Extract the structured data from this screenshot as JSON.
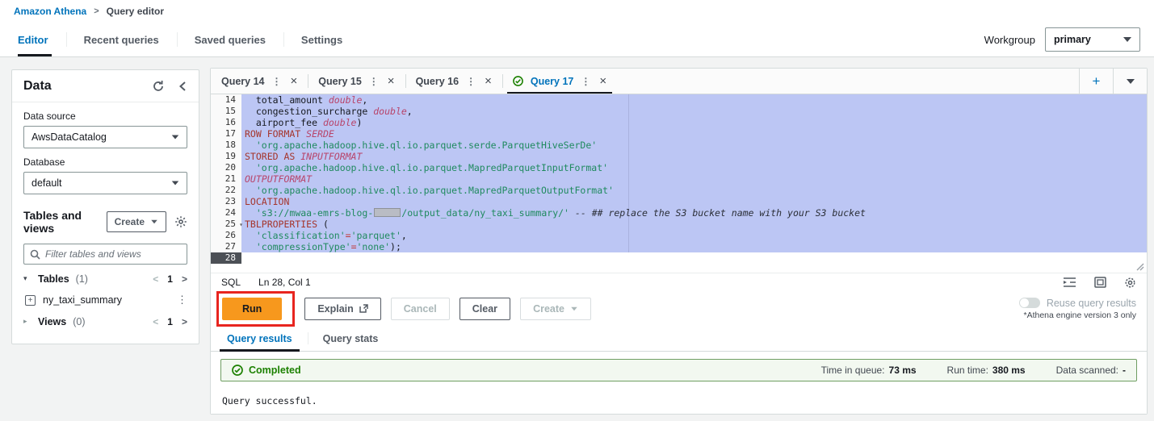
{
  "breadcrumb": {
    "root": "Amazon Athena",
    "sep": ">",
    "current": "Query editor"
  },
  "top_tabs": [
    {
      "label": "Editor",
      "active": true
    },
    {
      "label": "Recent queries",
      "active": false
    },
    {
      "label": "Saved queries",
      "active": false
    },
    {
      "label": "Settings",
      "active": false
    }
  ],
  "workgroup": {
    "label": "Workgroup",
    "value": "primary"
  },
  "sidebar": {
    "title": "Data",
    "data_source": {
      "label": "Data source",
      "value": "AwsDataCatalog"
    },
    "database": {
      "label": "Database",
      "value": "default"
    },
    "tables_and_views": {
      "title": "Tables and views",
      "create_button": "Create",
      "filter_placeholder": "Filter tables and views",
      "groups": [
        {
          "label": "Tables",
          "count": "(1)",
          "expanded": true,
          "prev": "<",
          "page": "1",
          "next": ">",
          "items": [
            "ny_taxi_summary"
          ]
        },
        {
          "label": "Views",
          "count": "(0)",
          "expanded": false,
          "prev": "<",
          "page": "1",
          "next": ">",
          "items": []
        }
      ]
    }
  },
  "editor": {
    "tabs": [
      {
        "label": "Query 14",
        "active": false,
        "completed": false
      },
      {
        "label": "Query 15",
        "active": false,
        "completed": false
      },
      {
        "label": "Query 16",
        "active": false,
        "completed": false
      },
      {
        "label": "Query 17",
        "active": true,
        "completed": true
      }
    ],
    "language": "SQL",
    "cursor_position": "Ln 28, Col 1",
    "lines": [
      {
        "num": "14",
        "selected": true,
        "segments": [
          {
            "t": "  total_amount ",
            "s": "p"
          },
          {
            "t": "double",
            "s": "t"
          },
          {
            "t": ",",
            "s": "p"
          }
        ]
      },
      {
        "num": "15",
        "selected": true,
        "segments": [
          {
            "t": "  congestion_surcharge ",
            "s": "p"
          },
          {
            "t": "double",
            "s": "t"
          },
          {
            "t": ",",
            "s": "p"
          }
        ]
      },
      {
        "num": "16",
        "selected": true,
        "segments": [
          {
            "t": "  airport_fee ",
            "s": "p"
          },
          {
            "t": "double",
            "s": "t"
          },
          {
            "t": ")",
            "s": "p"
          }
        ]
      },
      {
        "num": "17",
        "selected": true,
        "segments": [
          {
            "t": "ROW FORMAT ",
            "s": "k"
          },
          {
            "t": "SERDE",
            "s": "ki"
          }
        ]
      },
      {
        "num": "18",
        "selected": true,
        "segments": [
          {
            "t": "  ",
            "s": "p"
          },
          {
            "t": "'org.apache.hadoop.hive.ql.io.parquet.serde.ParquetHiveSerDe'",
            "s": "s"
          }
        ]
      },
      {
        "num": "19",
        "selected": true,
        "segments": [
          {
            "t": "STORED AS ",
            "s": "k"
          },
          {
            "t": "INPUTFORMAT",
            "s": "ki"
          }
        ]
      },
      {
        "num": "20",
        "selected": true,
        "segments": [
          {
            "t": "  ",
            "s": "p"
          },
          {
            "t": "'org.apache.hadoop.hive.ql.io.parquet.MapredParquetInputFormat'",
            "s": "s"
          }
        ]
      },
      {
        "num": "21",
        "selected": true,
        "segments": [
          {
            "t": "OUTPUTFORMAT",
            "s": "ki"
          }
        ]
      },
      {
        "num": "22",
        "selected": true,
        "segments": [
          {
            "t": "  ",
            "s": "p"
          },
          {
            "t": "'org.apache.hadoop.hive.ql.io.parquet.MapredParquetOutputFormat'",
            "s": "s"
          }
        ]
      },
      {
        "num": "23",
        "selected": true,
        "segments": [
          {
            "t": "LOCATION",
            "s": "k"
          }
        ]
      },
      {
        "num": "24",
        "selected": true,
        "segments": [
          {
            "t": "  ",
            "s": "p"
          },
          {
            "t": "'s3://mwaa-emrs-blog-",
            "s": "s"
          },
          {
            "t": "",
            "s": "r"
          },
          {
            "t": "/output_data/ny_taxi_summary/'",
            "s": "s"
          },
          {
            "t": " ",
            "s": "p"
          },
          {
            "t": "-- ## replace the S3 bucket name with your S3 bucket",
            "s": "c"
          }
        ]
      },
      {
        "num": "25",
        "selected": true,
        "fold": true,
        "segments": [
          {
            "t": "TBLPROPERTIES ",
            "s": "k"
          },
          {
            "t": "(",
            "s": "p"
          }
        ]
      },
      {
        "num": "26",
        "selected": true,
        "segments": [
          {
            "t": "  ",
            "s": "p"
          },
          {
            "t": "'classification'",
            "s": "s"
          },
          {
            "t": "=",
            "s": "o"
          },
          {
            "t": "'parquet'",
            "s": "s"
          },
          {
            "t": ",",
            "s": "p"
          }
        ]
      },
      {
        "num": "27",
        "selected": true,
        "segments": [
          {
            "t": "  ",
            "s": "p"
          },
          {
            "t": "'compressionType'",
            "s": "s"
          },
          {
            "t": "=",
            "s": "o"
          },
          {
            "t": "'none'",
            "s": "s"
          },
          {
            "t": ");",
            "s": "p"
          }
        ]
      },
      {
        "num": "28",
        "selected": false,
        "cursor": true,
        "segments": []
      }
    ]
  },
  "actions": {
    "run": "Run",
    "explain": "Explain",
    "cancel": "Cancel",
    "clear": "Clear",
    "create": "Create",
    "reuse_label": "Reuse query results",
    "reuse_note": "*Athena engine version 3 only"
  },
  "results": {
    "tabs": [
      {
        "label": "Query results",
        "active": true
      },
      {
        "label": "Query stats",
        "active": false
      }
    ],
    "status": "Completed",
    "metrics": [
      {
        "label": "Time in queue:",
        "value": "73 ms"
      },
      {
        "label": "Run time:",
        "value": "380 ms"
      },
      {
        "label": "Data scanned:",
        "value": "-"
      }
    ],
    "message": "Query successful."
  },
  "icons": {
    "dots": "⋮",
    "close": "×",
    "plus": "+",
    "caret_down": "▾",
    "caret_right": "▸",
    "fold": "▾"
  },
  "colors": {
    "accent_blue": "#0073bb",
    "success_green": "#1d8102",
    "run_orange": "#f7981d",
    "annotation_red": "#e8251f",
    "selection": "#bcc6f4"
  }
}
